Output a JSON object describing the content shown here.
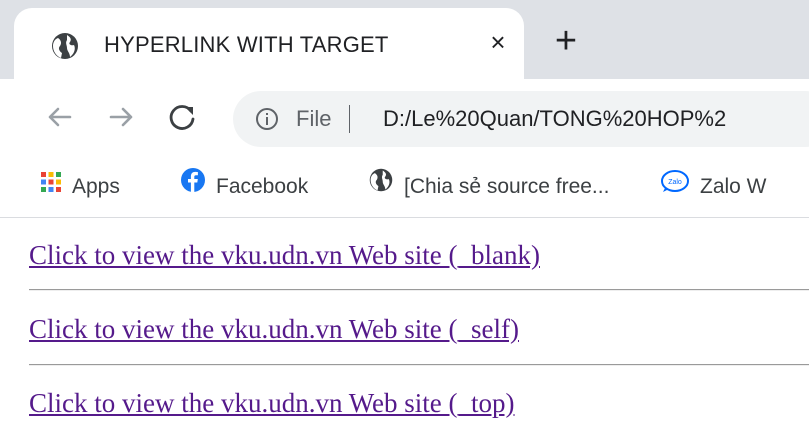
{
  "tab": {
    "title": "HYPERLINK WITH TARGET",
    "close_glyph": "×",
    "icon": "globe-icon"
  },
  "new_tab": {
    "glyph": "+"
  },
  "toolbar": {
    "back_icon": "back-arrow-icon",
    "forward_icon": "forward-arrow-icon",
    "reload_icon": "reload-icon",
    "info_icon": "info-icon",
    "scheme_label": "File",
    "url": "D:/Le%20Quan/TONG%20HOP%2"
  },
  "bookmarks": [
    {
      "label": "Apps",
      "icon": "apps-grid-icon"
    },
    {
      "label": "Facebook",
      "icon": "facebook-icon"
    },
    {
      "label": "[Chia sẻ source free...",
      "icon": "globe-icon"
    },
    {
      "label": "Zalo W",
      "icon": "zalo-icon"
    }
  ],
  "links": [
    {
      "text": "Click to view the vku.udn.vn Web site (_blank)"
    },
    {
      "text": "Click to view the vku.udn.vn Web site (_self)"
    },
    {
      "text": "Click to view the vku.udn.vn Web site (_top)"
    }
  ],
  "colors": {
    "tabstrip": "#dee1e6",
    "omnibox": "#f1f3f4",
    "visited_link": "#551a8b",
    "facebook": "#1877f2"
  }
}
